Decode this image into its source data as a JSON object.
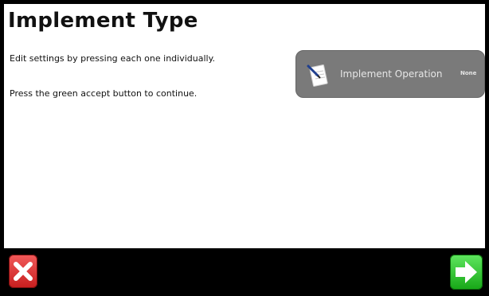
{
  "page": {
    "title": "Implement Type",
    "instruction_1": "Edit settings by pressing each one individually.",
    "instruction_2": "Press the green accept button to continue."
  },
  "settings": [
    {
      "label": "Implement Operation",
      "value": "None",
      "icon": "notepad-pen-icon"
    }
  ],
  "toolbar": {
    "cancel_icon": "close-icon",
    "accept_icon": "arrow-right-icon"
  },
  "colors": {
    "cancel": "#d92a2a",
    "accept": "#2ebf2e",
    "setting_button": "#7a7a7a",
    "background": "#ffffff",
    "frame": "#000000"
  }
}
